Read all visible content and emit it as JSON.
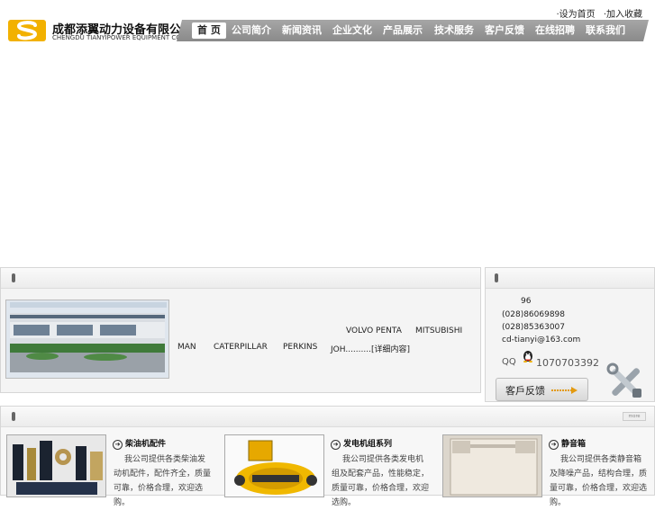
{
  "toplinks": [
    "·设为首页",
    "·加入收藏"
  ],
  "company": {
    "name_cn": "成都添翼动力设备有限公司",
    "name_en": "CHENGDU TIANYIPOWER EQUIPMENT CO.LTD"
  },
  "nav": [
    "首 页",
    "公司简介",
    "新闻资讯",
    "企业文化",
    "产品展示",
    "技术服务",
    "客户反馈",
    "在线招聘",
    "联系我们"
  ],
  "brands": {
    "row1": [
      "VOLVO PENTA",
      "MITSUBISHI"
    ],
    "row2": [
      "MAN",
      "CATERPILLAR",
      "PERKINS",
      "JOH..........[详细内容]"
    ]
  },
  "contact": {
    "line1": "96",
    "phone1": "(028)86069898",
    "phone2": "(028)85363007",
    "email": "cd-tianyi@163.com",
    "qq_label": "QQ",
    "qq_number": "1070703392",
    "feedback_label": "客戶反馈"
  },
  "more_label": "more",
  "products": [
    {
      "title": "柴油机配件",
      "desc": "我公司提供各类柴油发动机配件，配件齐全，质量可靠，价格合理，欢迎选购。"
    },
    {
      "title": "发电机组系列",
      "desc": "我公司提供各类发电机组及配套产品，性能稳定，质量可靠，价格合理，欢迎选购。"
    },
    {
      "title": "静音箱",
      "desc": "我公司提供各类静音箱及降噪产品，结构合理，质量可靠，价格合理，欢迎选购。"
    }
  ]
}
